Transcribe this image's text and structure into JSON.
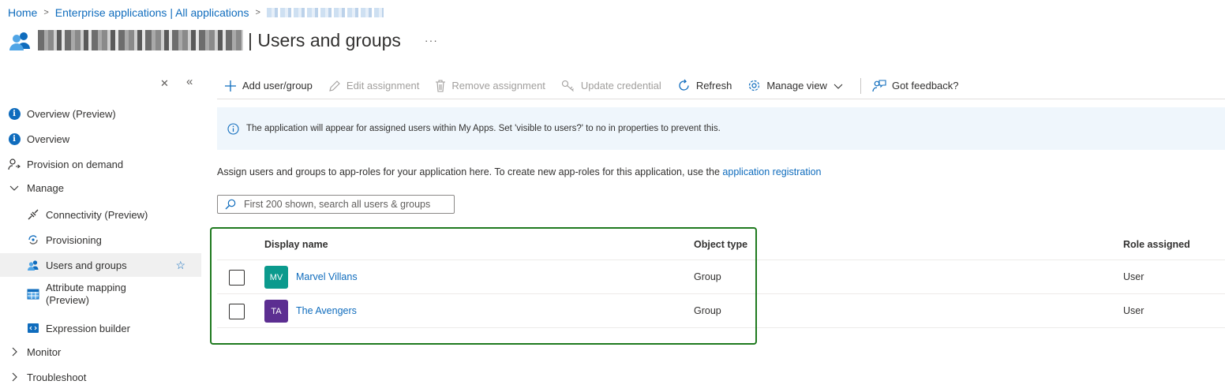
{
  "breadcrumb": {
    "home": "Home",
    "enterprise": "Enterprise applications | All applications"
  },
  "header": {
    "title": "| Users and groups",
    "more": "···"
  },
  "sidebar": {
    "items": [
      {
        "label": "Overview (Preview)",
        "icon": "info-icon"
      },
      {
        "label": "Overview",
        "icon": "info-icon"
      },
      {
        "label": "Provision on demand",
        "icon": "user-provision-icon"
      },
      {
        "label": "Manage",
        "icon": "chevron-down-icon"
      },
      {
        "label": "Connectivity (Preview)",
        "icon": "plug-icon"
      },
      {
        "label": "Provisioning",
        "icon": "sync-icon"
      },
      {
        "label": "Users and groups",
        "icon": "users-icon"
      },
      {
        "label": "Attribute mapping\n(Preview)",
        "icon": "table-icon"
      },
      {
        "label": "Expression builder",
        "icon": "code-icon"
      },
      {
        "label": "Monitor",
        "icon": "chevron-right-icon"
      },
      {
        "label": "Troubleshoot",
        "icon": "chevron-right-icon"
      }
    ]
  },
  "toolbar": {
    "add": "Add user/group",
    "edit": "Edit assignment",
    "remove": "Remove assignment",
    "update": "Update credential",
    "refresh": "Refresh",
    "manage_view": "Manage view",
    "feedback": "Got feedback?"
  },
  "banner": {
    "text": "The application will appear for assigned users within My Apps. Set 'visible to users?' to no in properties to prevent this."
  },
  "description": {
    "text": "Assign users and groups to app-roles for your application here. To create new app-roles for this application, use the ",
    "link": "application registration"
  },
  "search": {
    "placeholder": "First 200 shown, search all users & groups"
  },
  "table": {
    "columns": {
      "display_name": "Display name",
      "object_type": "Object type",
      "role": "Role assigned"
    },
    "rows": [
      {
        "initials": "MV",
        "name": "Marvel Villans",
        "type": "Group",
        "role": "User",
        "avatar_color": "#0b9a8d"
      },
      {
        "initials": "TA",
        "name": "The Avengers",
        "type": "Group",
        "role": "User",
        "avatar_color": "#5c2e91"
      }
    ]
  },
  "colors": {
    "accent": "#0f6cbd",
    "highlight": "#1f7a1f"
  }
}
